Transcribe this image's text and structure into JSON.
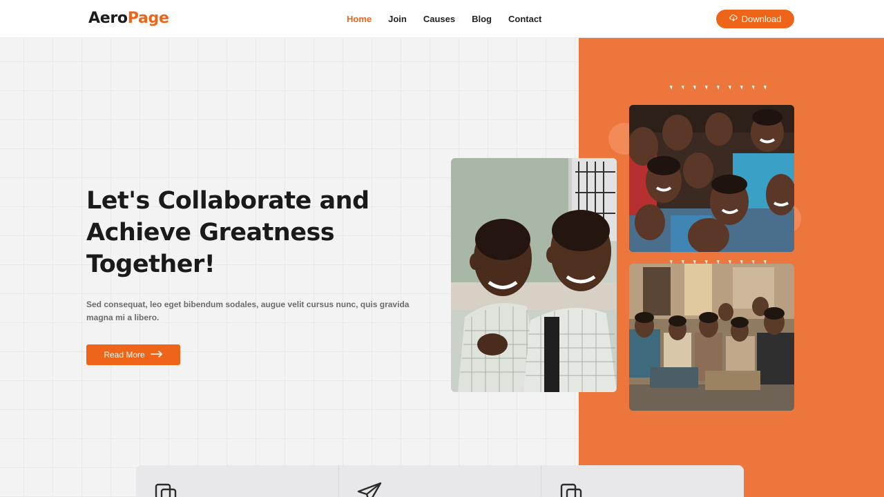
{
  "brand": {
    "part1": "Aero",
    "part2": "Page",
    "accent": "#ee6418"
  },
  "nav": {
    "items": [
      {
        "label": "Home",
        "active": true
      },
      {
        "label": "Join",
        "active": false
      },
      {
        "label": "Causes",
        "active": false
      },
      {
        "label": "Blog",
        "active": false
      },
      {
        "label": "Contact",
        "active": false
      }
    ]
  },
  "header": {
    "download_label": "Download",
    "download_icon": "cloud-download-icon"
  },
  "hero": {
    "title_lines": [
      "Let's Collaborate and",
      "Achieve Greatness",
      "Together!"
    ],
    "description": "Sed consequat, leo eget bibendum sodales, augue velit cursus nunc, quis gravida magna mi a libero.",
    "cta_label": "Read More",
    "cta_icon": "arrow-right-icon"
  },
  "images": [
    {
      "name": "two-boys-smiling-photo"
    },
    {
      "name": "group-of-children-photo"
    },
    {
      "name": "children-sitting-classroom-photo"
    }
  ],
  "features": [
    {
      "icon": "copy-icon"
    },
    {
      "icon": "paper-plane-icon"
    },
    {
      "icon": "copy-icon"
    }
  ],
  "colors": {
    "orange_panel": "#ec763c",
    "background": "#f3f3f4"
  }
}
